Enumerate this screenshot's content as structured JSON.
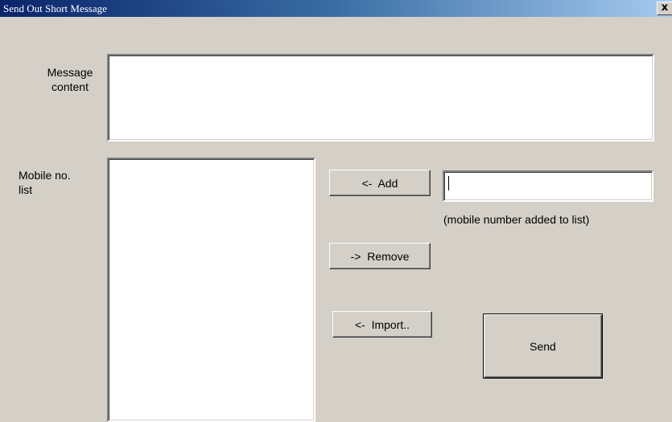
{
  "window": {
    "title": "Send Out Short Message",
    "close_label": "x"
  },
  "form": {
    "message_label": "Message\ncontent",
    "message_value": "",
    "mobile_list_label": "Mobile no.\nlist",
    "mobile_list_items": [],
    "mobile_input_value": "",
    "mobile_hint": "(mobile number added to list)"
  },
  "buttons": {
    "add": "<-  Add",
    "remove": "->  Remove",
    "import": "<-  Import..",
    "send": "Send"
  }
}
